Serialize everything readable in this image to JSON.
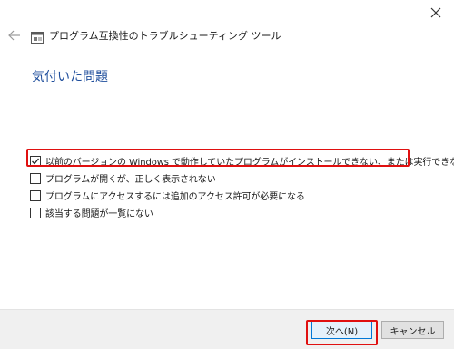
{
  "window": {
    "title": "プログラム互換性のトラブルシューティング ツール"
  },
  "main": {
    "heading": "気付いた問題",
    "options": [
      {
        "label": "以前のバージョンの Windows で動作していたプログラムがインストールできない、または実行できない",
        "checked": true
      },
      {
        "label": "プログラムが開くが、正しく表示されない",
        "checked": false
      },
      {
        "label": "プログラムにアクセスするには追加のアクセス許可が必要になる",
        "checked": false
      },
      {
        "label": "該当する問題が一覧にない",
        "checked": false
      }
    ]
  },
  "footer": {
    "next_label": "次へ(N)",
    "cancel_label": "キャンセル"
  },
  "colors": {
    "heading": "#1f4e9c",
    "highlight": "#e01010",
    "footer_bg": "#f0f0f0"
  }
}
